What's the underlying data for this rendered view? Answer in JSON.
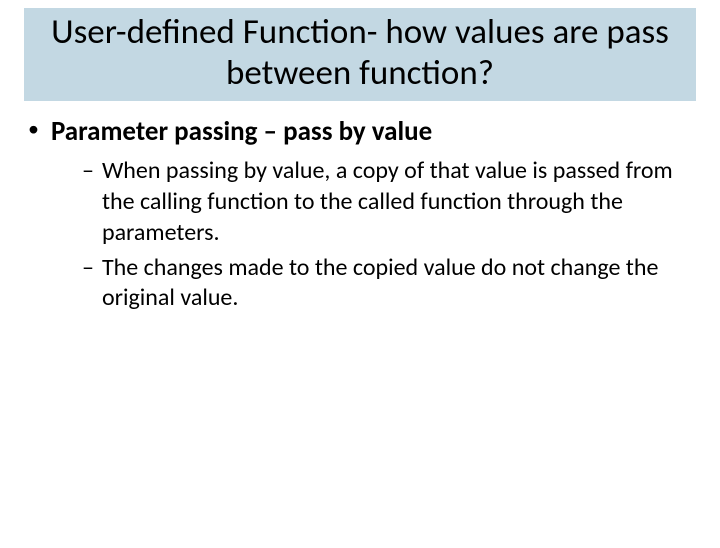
{
  "title": "User-defined Function- how values are pass between function?",
  "bullet_main": {
    "marker": "•",
    "text": "Parameter passing – pass by value"
  },
  "sub_bullets": [
    {
      "marker": "–",
      "text": "When passing by value, a copy of that value is passed from the calling function to the called function through the parameters."
    },
    {
      "marker": "–",
      "text": "The changes made to the copied value do not change the original value."
    }
  ]
}
